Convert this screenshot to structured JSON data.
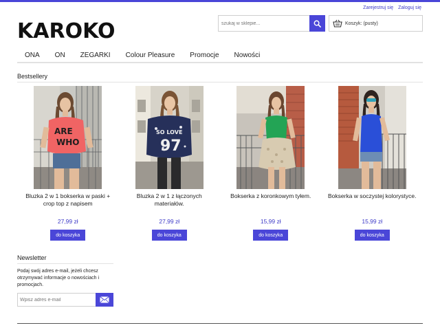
{
  "header": {
    "register_label": "Zarejestruj się",
    "login_label": "Zaloguj się",
    "logo_text": "KAROKO",
    "search_placeholder": "szukaj w sklepie...",
    "cart_label": "Koszyk: (pusty)"
  },
  "nav": {
    "items": [
      "ONA",
      "ON",
      "ZEGARKI",
      "Colour Pleasure",
      "Promocje",
      "Nowości"
    ]
  },
  "bestsellers": {
    "title": "Bestsellery",
    "products": [
      {
        "name": "Bluzka 2 w 1 bokserka w paski + crop top z napisem",
        "price": "27,99 zł",
        "button": "do koszyka",
        "photo": "woman-pink-top-photo"
      },
      {
        "name": "Bluzka 2 w 1 z łączonych materiałów.",
        "price": "27,99 zł",
        "button": "do koszyka",
        "photo": "woman-navy-top-photo"
      },
      {
        "name": "Bokserka z koronkowym tyłem.",
        "price": "15,99 zł",
        "button": "do koszyka",
        "photo": "woman-green-top-photo"
      },
      {
        "name": "Bokserka w soczystej kolorystyce.",
        "price": "15,99 zł",
        "button": "do koszyka",
        "photo": "woman-blue-top-photo"
      }
    ]
  },
  "newsletter": {
    "title": "Newsletter",
    "text": "Podaj swój adres e-mail, jeżeli chcesz otrzymywać informacje o nowościach i promocjach.",
    "email_placeholder": "Wpisz adres e-mail"
  },
  "colors": {
    "accent": "#4a46d8",
    "link": "#3b38c7"
  }
}
